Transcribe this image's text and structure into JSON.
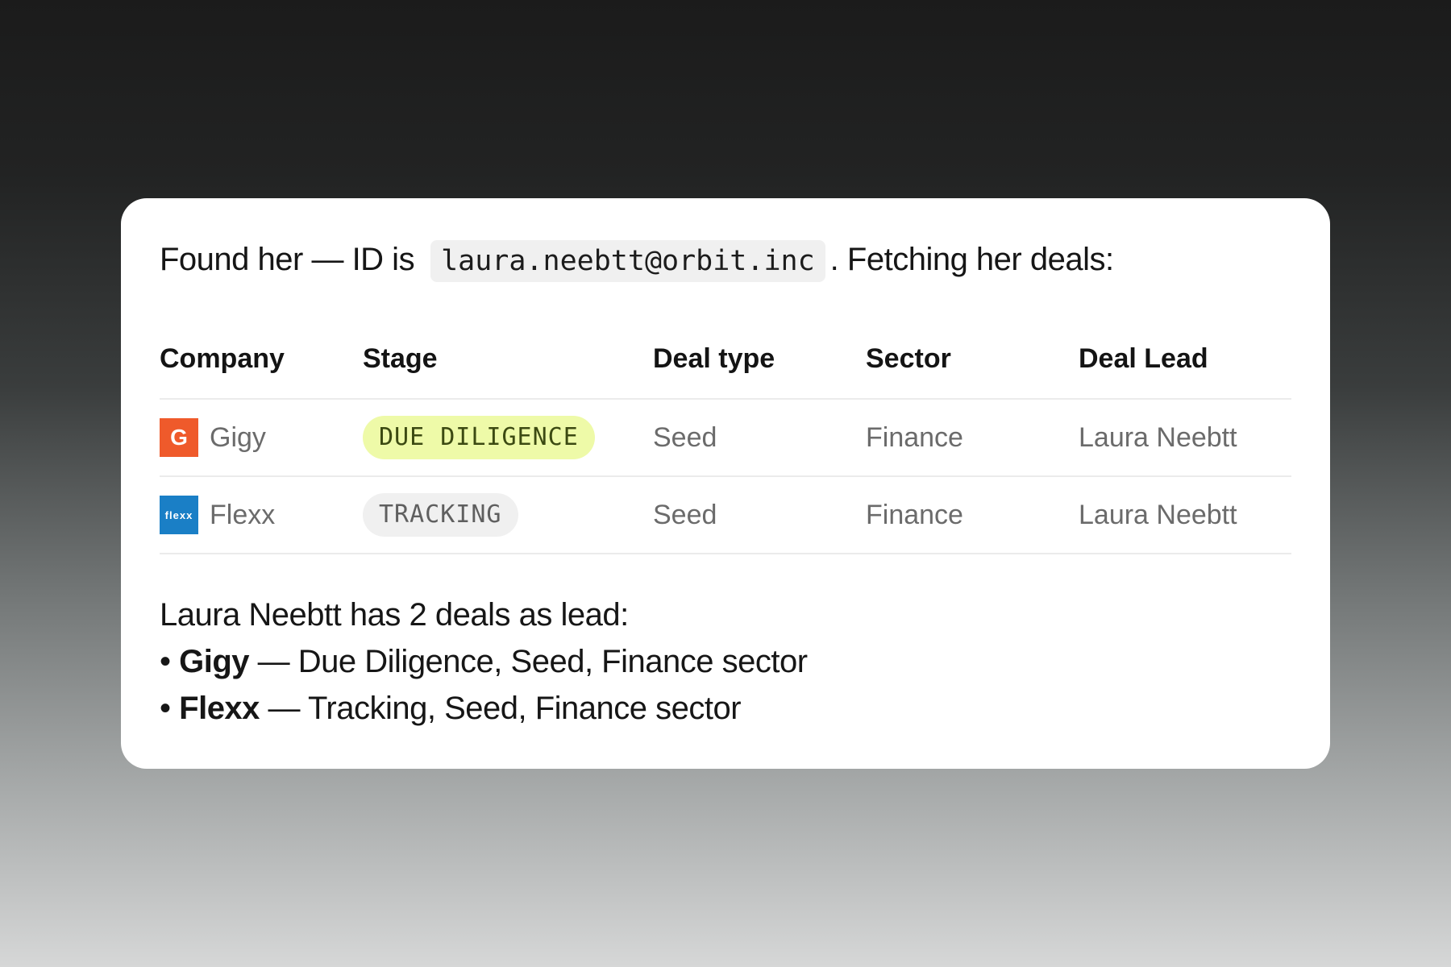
{
  "intro": {
    "prefix": "Found her — ID is",
    "user_id": "laura.neebtt@orbit.inc",
    "suffix": ". Fetching her deals:"
  },
  "table": {
    "headers": [
      "Company",
      "Stage",
      "Deal type",
      "Sector",
      "Deal Lead"
    ],
    "rows": [
      {
        "company": "Gigy",
        "logo_text": "G",
        "logo_color": "#ef5a2b",
        "stage": "DUE DILIGENCE",
        "stage_color": "#eefaa8",
        "deal_type": "Seed",
        "sector": "Finance",
        "deal_lead": "Laura Neebtt"
      },
      {
        "company": "Flexx",
        "logo_text": "flexx",
        "logo_color": "#1a7fc6",
        "stage": "TRACKING",
        "stage_color": "#f0f0f0",
        "deal_type": "Seed",
        "sector": "Finance",
        "deal_lead": "Laura Neebtt"
      }
    ]
  },
  "summary": {
    "heading": "Laura Neebtt has 2 deals as lead:",
    "bullet": "•",
    "items": [
      {
        "name": "Gigy",
        "detail": " — Due Diligence, Seed, Finance sector"
      },
      {
        "name": "Flexx",
        "detail": " — Tracking, Seed, Finance sector"
      }
    ]
  }
}
